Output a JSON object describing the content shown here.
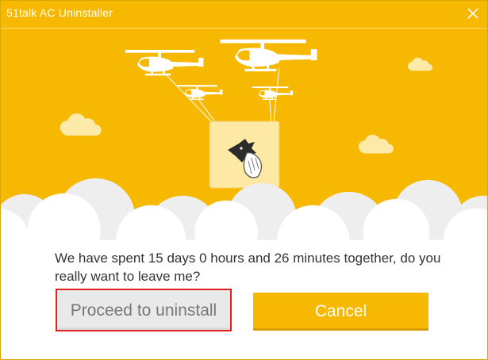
{
  "window": {
    "title": "51talk AC Uninstaller"
  },
  "colors": {
    "accent": "#f6b800",
    "accent_dark": "#d89e00",
    "highlight_border": "#e0201f",
    "text": "#333333"
  },
  "icons": {
    "close": "close-icon",
    "helicopter": "helicopter-icon",
    "box": "parcel-box-icon",
    "mascot": "wolf-wave-icon",
    "cloud": "cloud-icon"
  },
  "message": {
    "text": "We have spent 15 days 0 hours and 26 minutes together, do you really want to leave me?"
  },
  "buttons": {
    "proceed_label": "Proceed to uninstall",
    "cancel_label": "Cancel"
  }
}
